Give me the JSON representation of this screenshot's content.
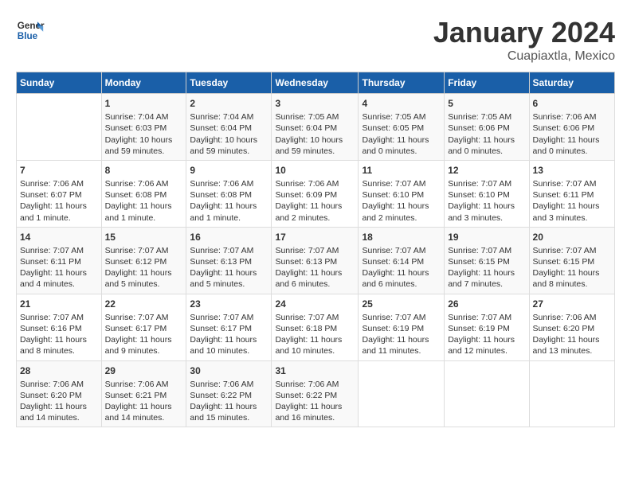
{
  "header": {
    "logo_line1": "General",
    "logo_line2": "Blue",
    "month_title": "January 2024",
    "subtitle": "Cuapiaxtla, Mexico"
  },
  "days_of_week": [
    "Sunday",
    "Monday",
    "Tuesday",
    "Wednesday",
    "Thursday",
    "Friday",
    "Saturday"
  ],
  "weeks": [
    [
      {
        "day": "",
        "info": ""
      },
      {
        "day": "1",
        "info": "Sunrise: 7:04 AM\nSunset: 6:03 PM\nDaylight: 10 hours\nand 59 minutes."
      },
      {
        "day": "2",
        "info": "Sunrise: 7:04 AM\nSunset: 6:04 PM\nDaylight: 10 hours\nand 59 minutes."
      },
      {
        "day": "3",
        "info": "Sunrise: 7:05 AM\nSunset: 6:04 PM\nDaylight: 10 hours\nand 59 minutes."
      },
      {
        "day": "4",
        "info": "Sunrise: 7:05 AM\nSunset: 6:05 PM\nDaylight: 11 hours\nand 0 minutes."
      },
      {
        "day": "5",
        "info": "Sunrise: 7:05 AM\nSunset: 6:06 PM\nDaylight: 11 hours\nand 0 minutes."
      },
      {
        "day": "6",
        "info": "Sunrise: 7:06 AM\nSunset: 6:06 PM\nDaylight: 11 hours\nand 0 minutes."
      }
    ],
    [
      {
        "day": "7",
        "info": "Sunrise: 7:06 AM\nSunset: 6:07 PM\nDaylight: 11 hours\nand 1 minute."
      },
      {
        "day": "8",
        "info": "Sunrise: 7:06 AM\nSunset: 6:08 PM\nDaylight: 11 hours\nand 1 minute."
      },
      {
        "day": "9",
        "info": "Sunrise: 7:06 AM\nSunset: 6:08 PM\nDaylight: 11 hours\nand 1 minute."
      },
      {
        "day": "10",
        "info": "Sunrise: 7:06 AM\nSunset: 6:09 PM\nDaylight: 11 hours\nand 2 minutes."
      },
      {
        "day": "11",
        "info": "Sunrise: 7:07 AM\nSunset: 6:10 PM\nDaylight: 11 hours\nand 2 minutes."
      },
      {
        "day": "12",
        "info": "Sunrise: 7:07 AM\nSunset: 6:10 PM\nDaylight: 11 hours\nand 3 minutes."
      },
      {
        "day": "13",
        "info": "Sunrise: 7:07 AM\nSunset: 6:11 PM\nDaylight: 11 hours\nand 3 minutes."
      }
    ],
    [
      {
        "day": "14",
        "info": "Sunrise: 7:07 AM\nSunset: 6:11 PM\nDaylight: 11 hours\nand 4 minutes."
      },
      {
        "day": "15",
        "info": "Sunrise: 7:07 AM\nSunset: 6:12 PM\nDaylight: 11 hours\nand 5 minutes."
      },
      {
        "day": "16",
        "info": "Sunrise: 7:07 AM\nSunset: 6:13 PM\nDaylight: 11 hours\nand 5 minutes."
      },
      {
        "day": "17",
        "info": "Sunrise: 7:07 AM\nSunset: 6:13 PM\nDaylight: 11 hours\nand 6 minutes."
      },
      {
        "day": "18",
        "info": "Sunrise: 7:07 AM\nSunset: 6:14 PM\nDaylight: 11 hours\nand 6 minutes."
      },
      {
        "day": "19",
        "info": "Sunrise: 7:07 AM\nSunset: 6:15 PM\nDaylight: 11 hours\nand 7 minutes."
      },
      {
        "day": "20",
        "info": "Sunrise: 7:07 AM\nSunset: 6:15 PM\nDaylight: 11 hours\nand 8 minutes."
      }
    ],
    [
      {
        "day": "21",
        "info": "Sunrise: 7:07 AM\nSunset: 6:16 PM\nDaylight: 11 hours\nand 8 minutes."
      },
      {
        "day": "22",
        "info": "Sunrise: 7:07 AM\nSunset: 6:17 PM\nDaylight: 11 hours\nand 9 minutes."
      },
      {
        "day": "23",
        "info": "Sunrise: 7:07 AM\nSunset: 6:17 PM\nDaylight: 11 hours\nand 10 minutes."
      },
      {
        "day": "24",
        "info": "Sunrise: 7:07 AM\nSunset: 6:18 PM\nDaylight: 11 hours\nand 10 minutes."
      },
      {
        "day": "25",
        "info": "Sunrise: 7:07 AM\nSunset: 6:19 PM\nDaylight: 11 hours\nand 11 minutes."
      },
      {
        "day": "26",
        "info": "Sunrise: 7:07 AM\nSunset: 6:19 PM\nDaylight: 11 hours\nand 12 minutes."
      },
      {
        "day": "27",
        "info": "Sunrise: 7:06 AM\nSunset: 6:20 PM\nDaylight: 11 hours\nand 13 minutes."
      }
    ],
    [
      {
        "day": "28",
        "info": "Sunrise: 7:06 AM\nSunset: 6:20 PM\nDaylight: 11 hours\nand 14 minutes."
      },
      {
        "day": "29",
        "info": "Sunrise: 7:06 AM\nSunset: 6:21 PM\nDaylight: 11 hours\nand 14 minutes."
      },
      {
        "day": "30",
        "info": "Sunrise: 7:06 AM\nSunset: 6:22 PM\nDaylight: 11 hours\nand 15 minutes."
      },
      {
        "day": "31",
        "info": "Sunrise: 7:06 AM\nSunset: 6:22 PM\nDaylight: 11 hours\nand 16 minutes."
      },
      {
        "day": "",
        "info": ""
      },
      {
        "day": "",
        "info": ""
      },
      {
        "day": "",
        "info": ""
      }
    ]
  ]
}
